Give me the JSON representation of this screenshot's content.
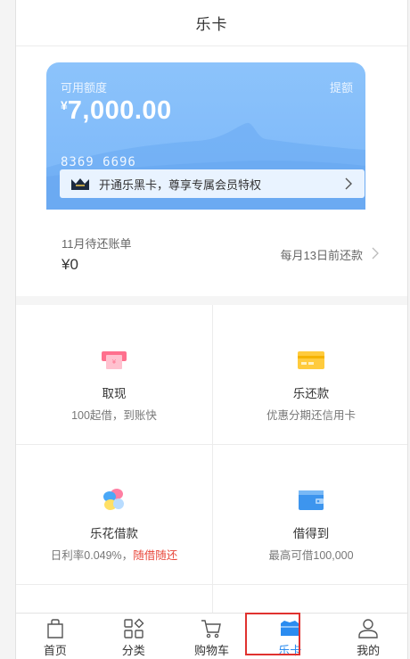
{
  "header": {
    "title": "乐卡"
  },
  "card": {
    "available_label": "可用额度",
    "withdraw_label": "提额",
    "currency": "¥",
    "amount": "7,000.00",
    "card_number": "8369 6696",
    "promo_text": "开通乐黑卡，尊享专属会员特权"
  },
  "bill": {
    "month_label": "11月待还账单",
    "amount": "¥0",
    "due_text": "每月13日前还款"
  },
  "services": [
    {
      "name": "取现",
      "desc": "100起借，到账快"
    },
    {
      "name": "乐还款",
      "desc": "优惠分期还信用卡"
    },
    {
      "name": "乐花借款",
      "desc_prefix": "日利率0.049%，",
      "desc_highlight": "随借随还"
    },
    {
      "name": "借得到",
      "desc": "最高可借100,000"
    }
  ],
  "tabs": [
    {
      "label": "首页",
      "icon": "bag-icon"
    },
    {
      "label": "分类",
      "icon": "grid-icon"
    },
    {
      "label": "购物车",
      "icon": "cart-icon"
    },
    {
      "label": "乐卡",
      "icon": "card-icon",
      "active": true
    },
    {
      "label": "我的",
      "icon": "user-icon"
    }
  ],
  "colors": {
    "accent": "#2b8cf0",
    "card": "#7ab6f8",
    "highlight_red": "#e8473b",
    "selection_box": "#e0322f"
  }
}
